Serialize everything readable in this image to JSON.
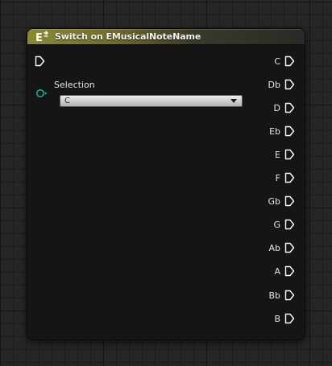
{
  "node": {
    "title": "Switch on EMusicalNoteName",
    "icon": "switch-enum-icon",
    "header_color": "#8b8a33",
    "exec_pin_color": "#ffffff",
    "data_pin_color": "#1bb39c"
  },
  "input": {
    "exec_pin": "exec-input-pin-icon",
    "selection_label": "Selection",
    "selection_value": "C"
  },
  "outputs": [
    {
      "label": "C"
    },
    {
      "label": "Db"
    },
    {
      "label": "D"
    },
    {
      "label": "Eb"
    },
    {
      "label": "E"
    },
    {
      "label": "F"
    },
    {
      "label": "Gb"
    },
    {
      "label": "G"
    },
    {
      "label": "Ab"
    },
    {
      "label": "A"
    },
    {
      "label": "Bb"
    },
    {
      "label": "B"
    }
  ]
}
